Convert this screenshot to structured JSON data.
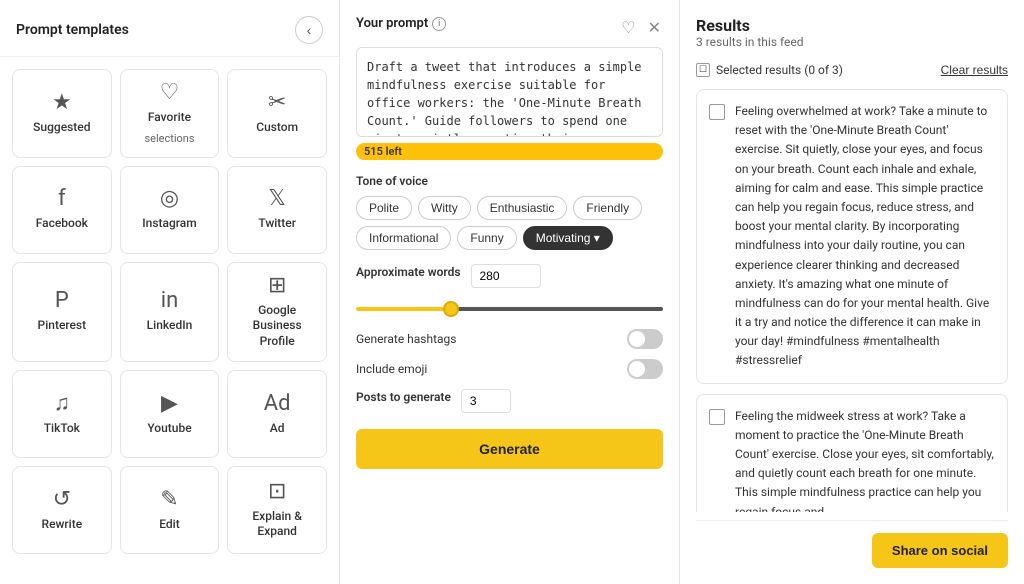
{
  "leftPanel": {
    "title": "Prompt templates",
    "items": [
      {
        "id": "suggested",
        "icon": "★",
        "label": "Suggested",
        "subLabel": ""
      },
      {
        "id": "favorite",
        "icon": "♡",
        "label": "Favorite",
        "subLabel": "selections"
      },
      {
        "id": "custom",
        "icon": "✂",
        "label": "Custom",
        "subLabel": ""
      },
      {
        "id": "facebook",
        "icon": "f",
        "label": "Facebook",
        "subLabel": ""
      },
      {
        "id": "instagram",
        "icon": "◎",
        "label": "Instagram",
        "subLabel": ""
      },
      {
        "id": "twitter",
        "icon": "𝕏",
        "label": "Twitter",
        "subLabel": ""
      },
      {
        "id": "pinterest",
        "icon": "P",
        "label": "Pinterest",
        "subLabel": ""
      },
      {
        "id": "linkedin",
        "icon": "in",
        "label": "LinkedIn",
        "subLabel": ""
      },
      {
        "id": "google-business",
        "icon": "⊞",
        "label": "Google Business Profile",
        "subLabel": ""
      },
      {
        "id": "tiktok",
        "icon": "♫",
        "label": "TikTok",
        "subLabel": ""
      },
      {
        "id": "youtube",
        "icon": "▶",
        "label": "Youtube",
        "subLabel": ""
      },
      {
        "id": "ad",
        "icon": "Ad",
        "label": "Ad",
        "subLabel": ""
      },
      {
        "id": "rewrite",
        "icon": "↺",
        "label": "Rewrite",
        "subLabel": ""
      },
      {
        "id": "edit",
        "icon": "✎",
        "label": "Edit",
        "subLabel": ""
      },
      {
        "id": "explain",
        "icon": "⊡",
        "label": "Explain & Expand",
        "subLabel": ""
      }
    ]
  },
  "middlePanel": {
    "sectionTitle": "Your prompt",
    "promptText": "Draft a tweet that introduces a simple mindfulness exercise suitable for office workers: the 'One-Minute Breath Count.' Guide followers to spend one minute quietly counting their",
    "charsLeft": "515 left",
    "toneLabel": "Tone of voice",
    "tones": [
      {
        "id": "polite",
        "label": "Polite",
        "active": false
      },
      {
        "id": "witty",
        "label": "Witty",
        "active": false
      },
      {
        "id": "enthusiastic",
        "label": "Enthusiastic",
        "active": false
      },
      {
        "id": "friendly",
        "label": "Friendly",
        "active": false
      },
      {
        "id": "informational",
        "label": "Informational",
        "active": false
      },
      {
        "id": "funny",
        "label": "Funny",
        "active": false
      },
      {
        "id": "motivating",
        "label": "Motivating ▾",
        "active": true
      }
    ],
    "approxLabel": "Approximate words",
    "approxValue": "280",
    "generateHashtagsLabel": "Generate hashtags",
    "includeEmojiLabel": "Include emoji",
    "postsLabel": "Posts to generate",
    "postsValue": "3",
    "generateBtn": "Generate"
  },
  "rightPanel": {
    "title": "Results",
    "countText": "3 results in this feed",
    "selectedText": "☐ Selected results (0 of 3)",
    "clearBtn": "Clear results",
    "results": [
      {
        "text": "Feeling overwhelmed at work? Take a minute to reset with the 'One-Minute Breath Count' exercise. Sit quietly, close your eyes, and focus on your breath. Count each inhale and exhale, aiming for calm and ease. This simple practice can help you regain focus, reduce stress, and boost your mental clarity. By incorporating mindfulness into your daily routine, you can experience clearer thinking and decreased anxiety. It's amazing what one minute of mindfulness can do for your mental health. Give it a try and notice the difference it can make in your day! #mindfulness #mentalhealth #stressrelief"
      },
      {
        "text": "Feeling the midweek stress at work? Take a moment to practice the 'One-Minute Breath Count' exercise. Close your eyes, sit comfortably, and quietly count each breath for one minute. This simple mindfulness practice can help you regain focus and"
      }
    ],
    "shareBtn": "Share on social"
  }
}
